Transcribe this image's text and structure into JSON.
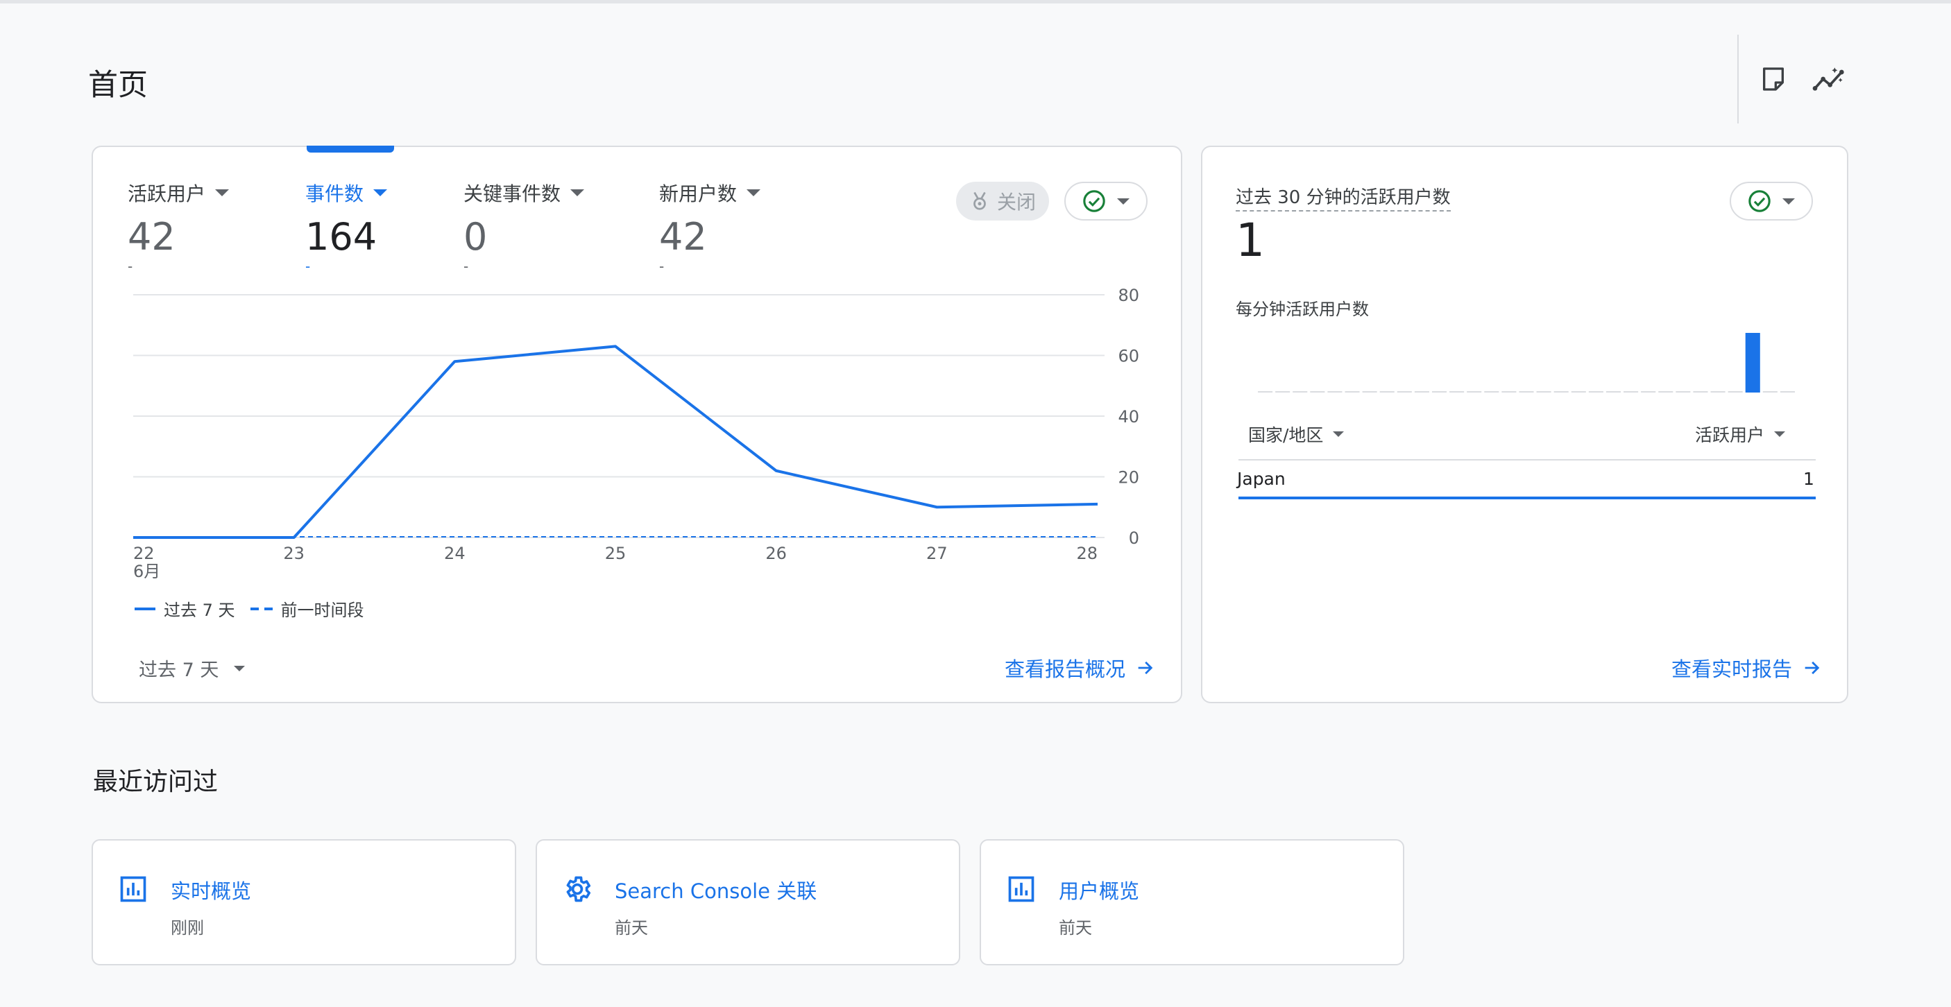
{
  "page": {
    "title": "首页"
  },
  "header": {
    "icons": [
      "note-icon",
      "insights-icon"
    ]
  },
  "overview": {
    "metrics": [
      {
        "label": "活跃用户",
        "value": "42",
        "delta": "-"
      },
      {
        "label": "事件数",
        "value": "164",
        "delta": "-"
      },
      {
        "label": "关键事件数",
        "value": "0",
        "delta": "-"
      },
      {
        "label": "新用户数",
        "value": "42",
        "delta": "-"
      }
    ],
    "active_metric_index": 1,
    "close_label": "关闭",
    "legend": {
      "current": "过去 7 天",
      "previous": "前一时间段"
    },
    "date_range": "过去 7 天",
    "view_report": "查看报告概况"
  },
  "chart_data": {
    "type": "line",
    "x": [
      "22",
      "23",
      "24",
      "25",
      "26",
      "27",
      "28"
    ],
    "x_sublabel_first": "6月",
    "series": [
      {
        "name": "过去 7 天",
        "values": [
          0,
          0,
          58,
          63,
          22,
          10,
          11
        ]
      },
      {
        "name": "前一时间段",
        "values": [
          0,
          0,
          0,
          0,
          0,
          0,
          0
        ]
      }
    ],
    "yticks": [
      "0",
      "20",
      "40",
      "60",
      "80"
    ],
    "ylim": [
      0,
      80
    ],
    "grid": true,
    "y_axis_side": "right"
  },
  "realtime": {
    "title": "过去 30 分钟的活跃用户数",
    "value": "1",
    "subtitle": "每分钟活跃用户数",
    "minute_bars": [
      0,
      0,
      0,
      0,
      0,
      0,
      0,
      0,
      0,
      0,
      0,
      0,
      0,
      0,
      0,
      0,
      0,
      0,
      0,
      0,
      0,
      0,
      0,
      0,
      0,
      0,
      0,
      0,
      1,
      0,
      0
    ],
    "col_country": "国家/地区",
    "col_users": "活跃用户",
    "rows": [
      {
        "country": "Japan",
        "users": "1"
      }
    ],
    "view_report": "查看实时报告"
  },
  "recent": {
    "title": "最近访问过",
    "items": [
      {
        "title": "实时概览",
        "time": "刚刚",
        "icon": "bar-chart-icon"
      },
      {
        "title": "Search Console 关联",
        "time": "前天",
        "icon": "gear-icon"
      },
      {
        "title": "用户概览",
        "time": "前天",
        "icon": "bar-chart-icon"
      }
    ]
  }
}
